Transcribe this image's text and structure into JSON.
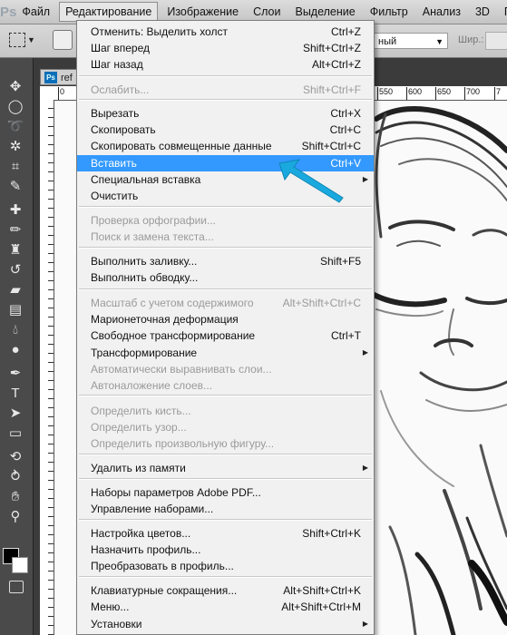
{
  "app": {
    "logo": "Ps"
  },
  "menubar": {
    "items": [
      "Файл",
      "Редактирование",
      "Изображение",
      "Слои",
      "Выделение",
      "Фильтр",
      "Анализ",
      "3D",
      "Пр"
    ],
    "active_index": 1
  },
  "options": {
    "style_value": "ный",
    "width_label": "Шир.:"
  },
  "document": {
    "tab_title": "ref",
    "tab_icon": "Ps",
    "ruler_h": [
      "0",
      "550",
      "600",
      "650",
      "700",
      "7"
    ]
  },
  "edit_menu": {
    "rows": [
      {
        "label": "Отменить: Выделить холст",
        "shortcut": "Ctrl+Z",
        "disabled": false
      },
      {
        "label": "Шаг вперед",
        "shortcut": "Shift+Ctrl+Z",
        "disabled": false
      },
      {
        "label": "Шаг назад",
        "shortcut": "Alt+Ctrl+Z",
        "disabled": false
      },
      {
        "label": "Ослабить...",
        "shortcut": "Shift+Ctrl+F",
        "disabled": true
      },
      {
        "label": "Вырезать",
        "shortcut": "Ctrl+X",
        "disabled": false
      },
      {
        "label": "Скопировать",
        "shortcut": "Ctrl+C",
        "disabled": false
      },
      {
        "label": "Скопировать совмещенные данные",
        "shortcut": "Shift+Ctrl+C",
        "disabled": false
      },
      {
        "label": "Вставить",
        "shortcut": "Ctrl+V",
        "disabled": false,
        "highlighted": true
      },
      {
        "label": "Специальная вставка",
        "shortcut": "",
        "disabled": false,
        "submenu": true
      },
      {
        "label": "Очистить",
        "shortcut": "",
        "disabled": false
      },
      {
        "label": "Проверка орфографии...",
        "shortcut": "",
        "disabled": true
      },
      {
        "label": "Поиск и замена текста...",
        "shortcut": "",
        "disabled": true
      },
      {
        "label": "Выполнить заливку...",
        "shortcut": "Shift+F5",
        "disabled": false
      },
      {
        "label": "Выполнить обводку...",
        "shortcut": "",
        "disabled": false
      },
      {
        "label": "Масштаб с учетом содержимого",
        "shortcut": "Alt+Shift+Ctrl+C",
        "disabled": true
      },
      {
        "label": "Марионеточная деформация",
        "shortcut": "",
        "disabled": false
      },
      {
        "label": "Свободное трансформирование",
        "shortcut": "Ctrl+T",
        "disabled": false
      },
      {
        "label": "Трансформирование",
        "shortcut": "",
        "disabled": false,
        "submenu": true
      },
      {
        "label": "Автоматически выравнивать слои...",
        "shortcut": "",
        "disabled": true
      },
      {
        "label": "Автоналожение слоев...",
        "shortcut": "",
        "disabled": true
      },
      {
        "label": "Определить кисть...",
        "shortcut": "",
        "disabled": true
      },
      {
        "label": "Определить узор...",
        "shortcut": "",
        "disabled": true
      },
      {
        "label": "Определить произвольную фигуру...",
        "shortcut": "",
        "disabled": true
      },
      {
        "label": "Удалить из памяти",
        "shortcut": "",
        "disabled": false,
        "submenu": true
      },
      {
        "label": "Наборы параметров Adobe PDF...",
        "shortcut": "",
        "disabled": false
      },
      {
        "label": "Управление наборами...",
        "shortcut": "",
        "disabled": false
      },
      {
        "label": "Настройка цветов...",
        "shortcut": "Shift+Ctrl+K",
        "disabled": false
      },
      {
        "label": "Назначить профиль...",
        "shortcut": "",
        "disabled": false
      },
      {
        "label": "Преобразовать в профиль...",
        "shortcut": "",
        "disabled": false
      },
      {
        "label": "Клавиатурные сокращения...",
        "shortcut": "Alt+Shift+Ctrl+K",
        "disabled": false
      },
      {
        "label": "Меню...",
        "shortcut": "Alt+Shift+Ctrl+M",
        "disabled": false
      },
      {
        "label": "Установки",
        "shortcut": "",
        "disabled": false,
        "submenu": true
      }
    ]
  },
  "colors": {
    "highlight": "#3399ff",
    "arrow": "#1aa9df",
    "foreground": "#000000",
    "background": "#ffffff"
  },
  "tools": [
    "move-icon",
    "ellipse-marquee-icon",
    "lasso-icon",
    "quick-select-icon",
    "crop-icon",
    "eyedropper-icon",
    "healing-icon",
    "brush-icon",
    "clone-stamp-icon",
    "history-brush-icon",
    "eraser-icon",
    "gradient-icon",
    "blur-icon",
    "dodge-icon",
    "pen-icon",
    "type-icon",
    "path-select-icon",
    "rectangle-icon",
    "3d-rotate-icon",
    "3d-orbit-icon",
    "hand-icon",
    "zoom-icon"
  ]
}
